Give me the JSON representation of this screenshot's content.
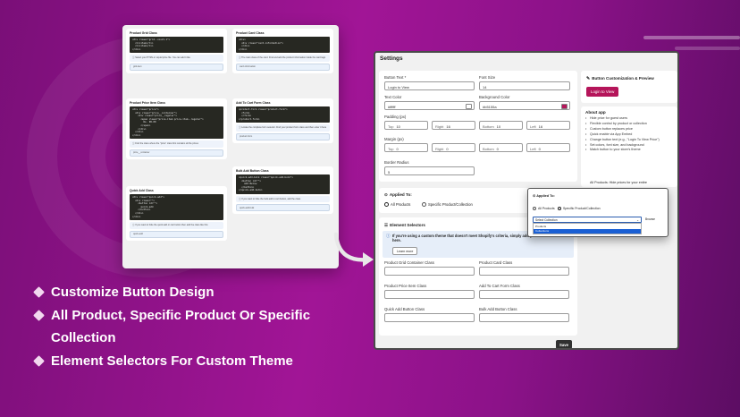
{
  "shot1": {
    "left_cards": [
      {
        "title": "Product Grid Class",
        "code": [
          "<div class=\"grid--count-1\">",
          "  <li>item</li>",
          "  <li>item</li>",
          "</div>"
        ],
        "note": "Select your HTML or Liquid price file. You can add it like",
        "field": "grid-item"
      },
      {
        "title": "Product Price Item Class",
        "code": [
          "<div class=\"price\">",
          "  <div class=\"price__container\">",
          "    <div class=\"price__regular\">",
          "      <span class=\"price-item price-item--regular\">",
          "        Rs. 98.00",
          "      </span>",
          "    </div>",
          "  </div>",
          "</div>"
        ],
        "note": "Find the class where the \"price\" class first contains all the prices",
        "field": "price__container"
      },
      {
        "title": "Quick Add Class",
        "code": [
          "<div class=\"quick-add\">",
          "  <div class=\"\">",
          "    <button id=\"\">",
          "      quick-add",
          "    </button>",
          "  </div>",
          "</div>"
        ],
        "note": "If you want to hide the quick add or cart button then add the class like this",
        "field": "quick-add"
      }
    ],
    "right_cards": [
      {
        "title": "Product Card Class",
        "code": [
          "<div>",
          "  <div class=\"card-information\">",
          "  </div>",
          "</div>"
        ],
        "note": "The main class of the card. Find and add the product information inside the card tags",
        "field": "card-information"
      },
      {
        "title": "Add To Cart Form Class",
        "code": [
          "<product-form class=\"product-form\">",
          "  <form>",
          "  </form>",
          "</product-form>"
        ],
        "note": "Locate the complete form selector. Find your product form class and then enter it here",
        "field": "product-form"
      },
      {
        "title": "Bulk Add Button Class",
        "code": [
          "<quick-add-bulk class=\"quick-add-bulk\">",
          "  <button id=\"\">",
          "    Add Below",
          "  </button>",
          "</quick-add-bulk>"
        ],
        "note": "If you want to hide the bulk add to cart button, add the class",
        "field": "quick-add-bulk"
      }
    ]
  },
  "settings": {
    "title": "Settings",
    "button_text_label": "Button Text *",
    "button_text_value": "Login to View",
    "font_size_label": "Font Size",
    "font_size_value": "14",
    "text_color_label": "Text Color",
    "text_color_value": "#ffffff",
    "text_color_hex": "#ffffff",
    "bg_color_label": "Background Color",
    "bg_color_value": "#b5155a",
    "bg_color_hex": "#b5155a",
    "padding_label": "Padding (px)",
    "padding": [
      {
        "label": "Top",
        "value": "10"
      },
      {
        "label": "Right",
        "value": "16"
      },
      {
        "label": "Bottom",
        "value": "10"
      },
      {
        "label": "Left",
        "value": "16"
      }
    ],
    "margin_label": "Margin (px)",
    "margin": [
      {
        "label": "Top",
        "value": "0"
      },
      {
        "label": "Right",
        "value": "0"
      },
      {
        "label": "Bottom",
        "value": "0"
      },
      {
        "label": "Left",
        "value": "0"
      }
    ],
    "border_radius_label": "Border Radius",
    "border_radius_value": "5",
    "preview_title": "Button Customization & Preview",
    "preview_button": "Login to View",
    "about_title": "About app",
    "about_items": [
      "Hide price for guest users",
      "Flexible control by product or collection",
      "Custom button replaces price",
      "Quick enable via App Embed",
      "Change button text (e.g., \"Login To View Price\")",
      "Set colors, font size, and background",
      "Match button to your store's theme"
    ],
    "about_cut": "All Products: Hide prices for your entire",
    "applied_title": "Applied To:",
    "option_all": "All Products",
    "option_specific": "Specific Product/Collection",
    "selectors_title": "Element Selectors",
    "info_text": "If you're using a custom theme that doesn't meet Shopify's criteria, simply add your custom class here.",
    "learn_more": "Learn more",
    "selector_labels": [
      "Product Grid Container Class",
      "Product Card Class",
      "Product Price Item Class",
      "Add To Cart Form Class",
      "Quick Add Button Class",
      "Bulk Add Button Class"
    ],
    "save": "Save"
  },
  "popup": {
    "title": "Applied To:",
    "option_all": "All Products",
    "option_specific": "Specific Product/Collection",
    "select_value": "Select Collection",
    "browse": "Browse",
    "options": [
      "Products",
      "Collections"
    ]
  },
  "features": [
    "Customize Button Design",
    "All Product, Specific Product Or Specific",
    "Collection",
    "Element Selectors For Custom Theme"
  ]
}
